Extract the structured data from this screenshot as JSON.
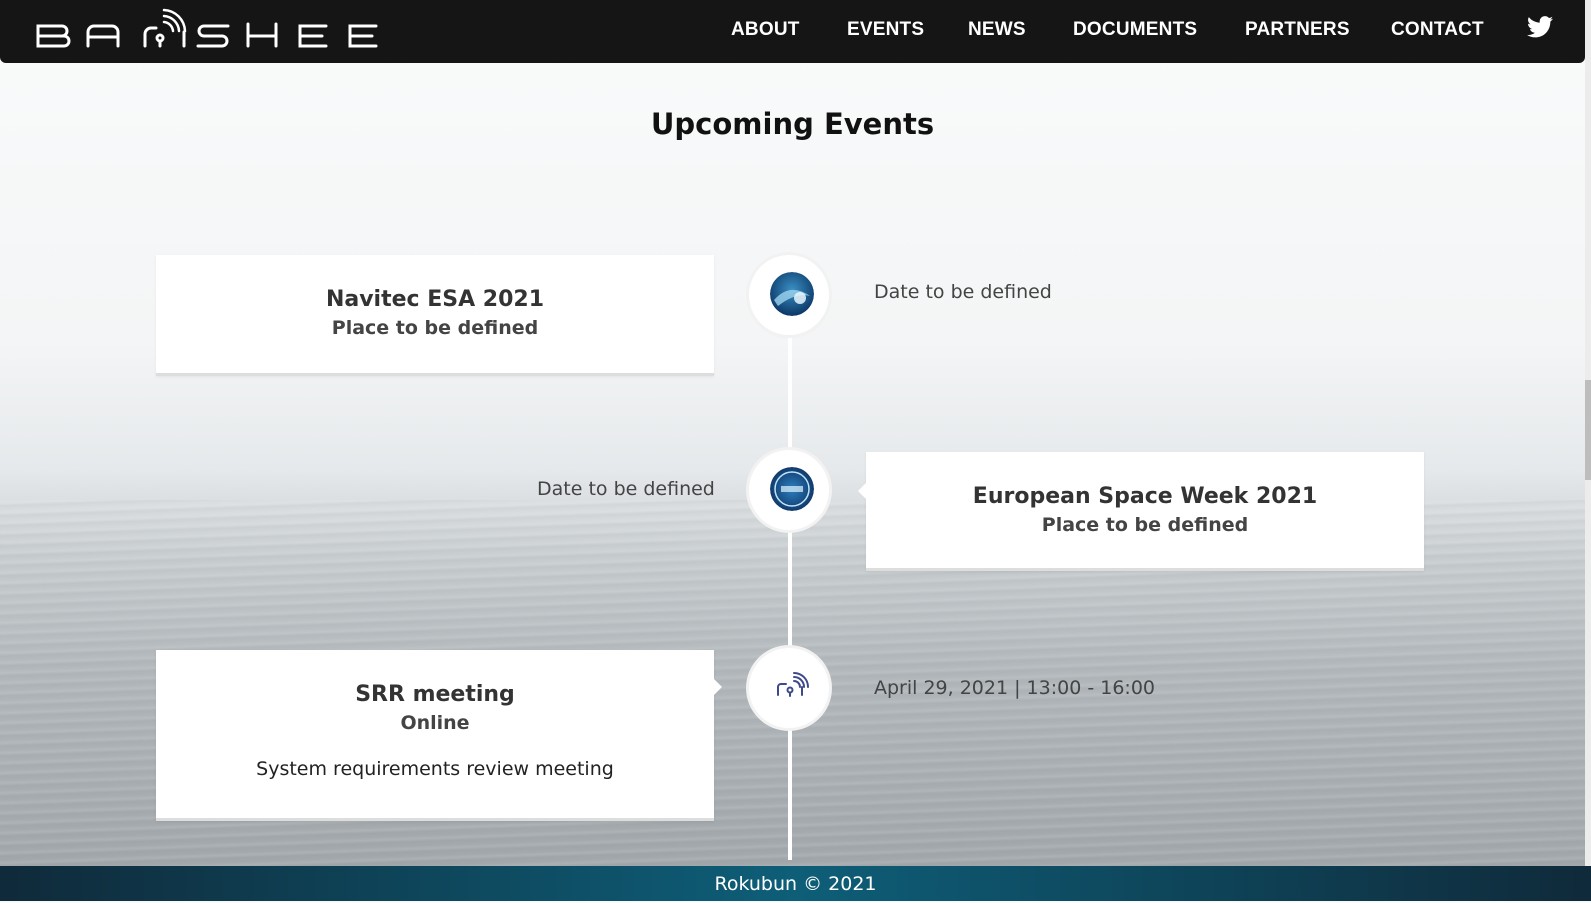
{
  "brand": {
    "name": "BANSHEE"
  },
  "nav": {
    "items": [
      {
        "label": "ABOUT"
      },
      {
        "label": "EVENTS"
      },
      {
        "label": "NEWS"
      },
      {
        "label": "DOCUMENTS"
      },
      {
        "label": "PARTNERS"
      },
      {
        "label": "CONTACT"
      }
    ],
    "social_icon": "twitter-icon"
  },
  "page": {
    "title": "Upcoming Events"
  },
  "events": [
    {
      "title": "Navitec ESA 2021",
      "place": "Place to be defined",
      "date": "Date to be defined",
      "icon": "navitec-logo"
    },
    {
      "title": "European Space Week 2021",
      "place": "Place to be defined",
      "date": "Date to be defined",
      "icon": "space-week-logo"
    },
    {
      "title": "SRR meeting",
      "place": "Online",
      "date": "April 29, 2021 | 13:00 - 16:00",
      "description": "System requirements review meeting",
      "icon": "banshee-signal-logo"
    }
  ],
  "footer": {
    "text": "Rokubun © 2021"
  },
  "colors": {
    "nav_bg": "#151515",
    "footer_accent": "#0e5e78"
  }
}
